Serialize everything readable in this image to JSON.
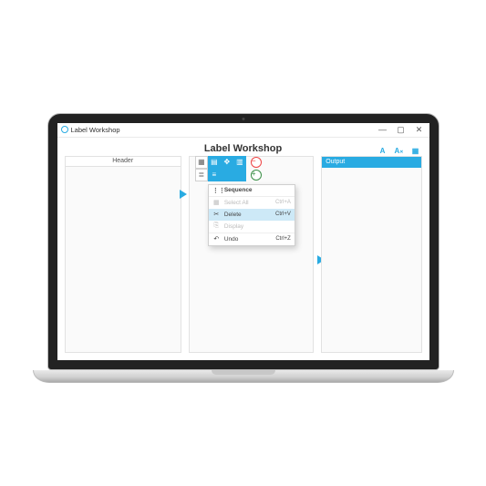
{
  "window": {
    "title": "Label Workshop",
    "minimize": "—",
    "maximize": "▢",
    "close": "✕"
  },
  "app": {
    "title": "Label Workshop"
  },
  "left_panel": {
    "header": "Header"
  },
  "right_panel": {
    "header": "Output",
    "icons": {
      "a": "A",
      "ax": "A",
      "axsub": "✕",
      "box": "▦"
    }
  },
  "center_toolbar": {
    "grid": "▦",
    "barcode": "▤",
    "move": "✥",
    "layers": "▥",
    "list": "≣",
    "text": "≡",
    "minus": "−",
    "plus": "+"
  },
  "context_menu": {
    "header": "Sequence",
    "items": [
      {
        "icon": "▦",
        "label": "Select All",
        "shortcut": "Ctrl+A",
        "state": "disabled"
      },
      {
        "icon": "✂",
        "label": "Delete",
        "shortcut": "Ctrl+V",
        "state": "highlight"
      },
      {
        "icon": "⎘",
        "label": "Display",
        "shortcut": "",
        "state": "disabled"
      },
      {
        "icon": "↶",
        "label": "Undo",
        "shortcut": "Ctrl+Z",
        "state": "normal"
      }
    ]
  }
}
